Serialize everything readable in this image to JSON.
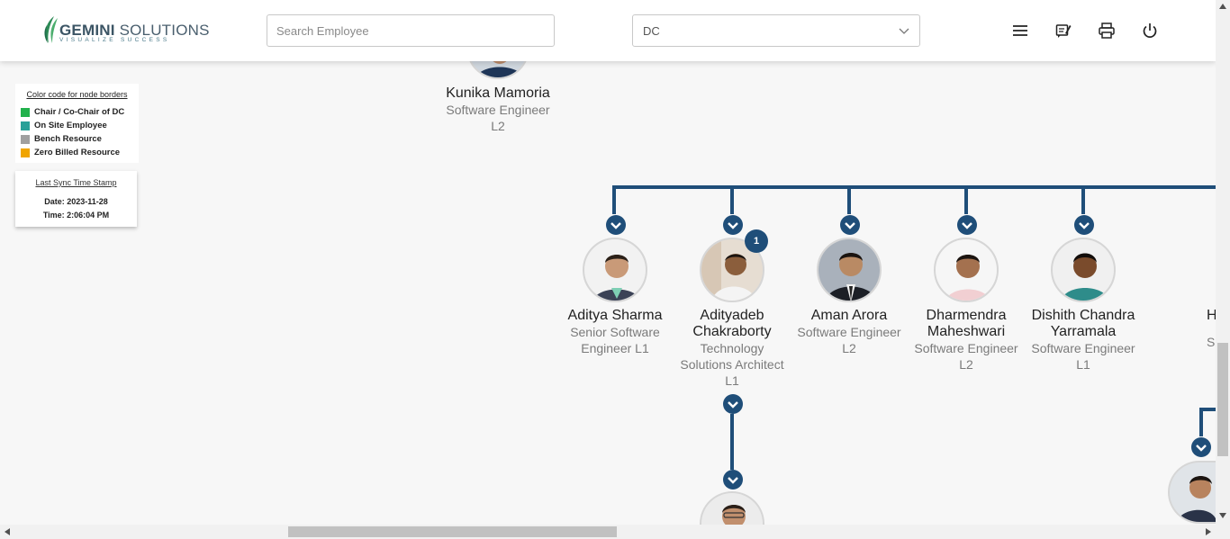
{
  "header": {
    "logo_name": "GEMINI",
    "logo_name2": "SOLUTIONS",
    "logo_tagline": "VISUALIZE SUCCESS",
    "search_placeholder": "Search Employee",
    "dc_select_value": "DC",
    "icons": [
      "menu-icon",
      "feedback-icon",
      "print-icon",
      "power-icon"
    ]
  },
  "legend": {
    "title": "Color code for node borders",
    "items": [
      {
        "label": "Chair / Co-Chair of DC",
        "color": "#22b14c"
      },
      {
        "label": "On Site Employee",
        "color": "#2aa198"
      },
      {
        "label": "Bench Resource",
        "color": "#a0a0a0"
      },
      {
        "label": "Zero Billed Resource",
        "color": "#f0a500"
      }
    ]
  },
  "sync": {
    "title": "Last Sync Time Stamp",
    "date": "Date: 2023-11-28",
    "time": "Time: 2:06:04 PM"
  },
  "nodes": [
    {
      "name": "Kunika Mamoria",
      "title": "Software Engineer L2"
    },
    {
      "name": "Aditya Sharma",
      "title": "Senior Software Engineer L1"
    },
    {
      "name": "Adityadeb Chakraborty",
      "title": "Technology Solutions Architect L1",
      "badge": "1"
    },
    {
      "name": "Aman Arora",
      "title": "Software Engineer L2"
    },
    {
      "name": "Dharmendra Maheshwari",
      "title": "Software Engineer L2"
    },
    {
      "name": "Dishith Chandra Yarramala",
      "title": "Software Engineer L1"
    },
    {
      "name": "H",
      "title": "S"
    }
  ],
  "colors": {
    "connector": "#1f4e79",
    "accent": "#1f4e79"
  }
}
